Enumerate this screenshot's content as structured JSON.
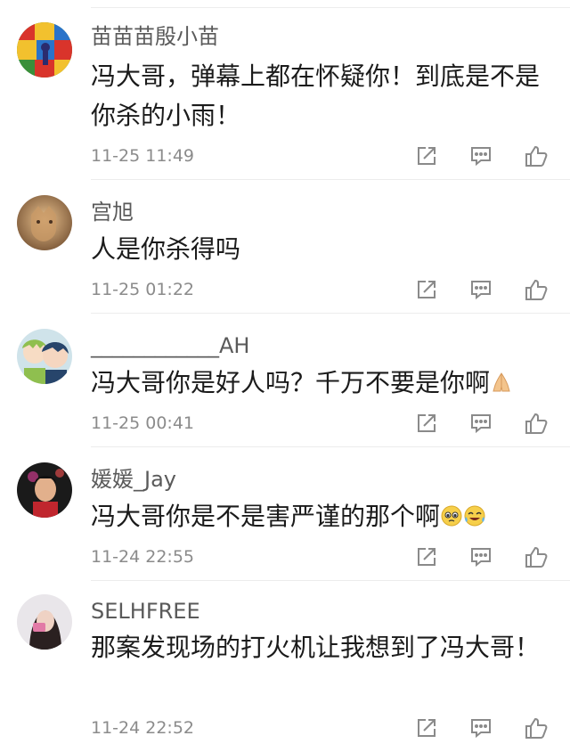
{
  "comments": [
    {
      "username": "苗苗苗殷小苗",
      "text": "冯大哥，弹幕上都在怀疑你！到底是不是你杀的小雨！",
      "time": "11-25 11:49"
    },
    {
      "username": "宫旭",
      "text": "人是你杀得吗",
      "time": "11-25 01:22"
    },
    {
      "username": "____________AH",
      "text": "冯大哥你是好人吗？千万不要是你啊",
      "time": "11-25 00:41"
    },
    {
      "username": "媛媛_Jay",
      "text": "冯大哥你是不是害严谨的那个啊",
      "time": "11-24 22:55"
    },
    {
      "username": "SELHFREE",
      "text": "那案发现场的打火机让我想到了冯大哥！",
      "time": "11-24 22:52"
    }
  ],
  "icons": {
    "share": "share-icon",
    "reply": "comment-icon",
    "like": "thumbs-up-icon"
  }
}
